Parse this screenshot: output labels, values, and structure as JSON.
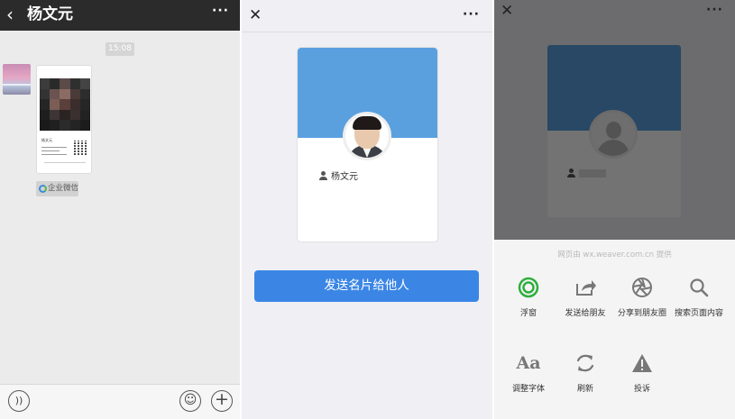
{
  "chat": {
    "back_glyph": "‹",
    "title": "杨文元",
    "more_glyph": "···",
    "time": "15:08",
    "card_preview": {
      "name": "杨文元"
    },
    "source_tag": "企业微信",
    "bottom": {
      "voice_icon": "voice-icon",
      "emoji_icon": "emoji-icon",
      "plus_icon": "plus-icon"
    }
  },
  "card_view": {
    "close_glyph": "✕",
    "more_glyph": "···",
    "name": "杨文元",
    "send_label": "发送名片给他人",
    "colors": {
      "card_header": "#5aa0df",
      "button": "#3b86e5"
    }
  },
  "share_menu": {
    "close_glyph": "✕",
    "more_glyph": "···",
    "url_hint": "网页由 wx.weaver.com.cn 提供",
    "actions": [
      {
        "label": "浮窗",
        "icon": "float-window-icon"
      },
      {
        "label": "发送给朋友",
        "icon": "share-arrow-icon"
      },
      {
        "label": "分享到朋友圈",
        "icon": "moments-aperture-icon"
      },
      {
        "label": "搜索页面内容",
        "icon": "search-icon"
      },
      {
        "label": "调整字体",
        "icon": "font-size-icon",
        "glyph": "Aa"
      },
      {
        "label": "刷新",
        "icon": "refresh-icon"
      },
      {
        "label": "投诉",
        "icon": "warning-icon"
      }
    ]
  }
}
